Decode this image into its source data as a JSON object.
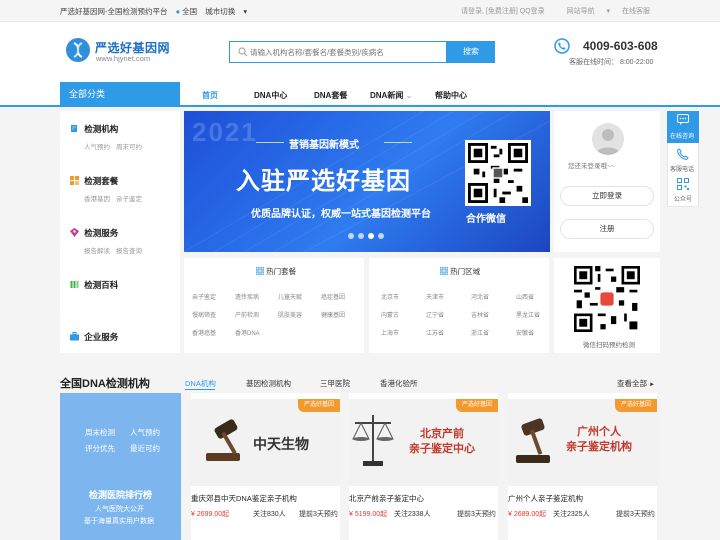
{
  "topbar": {
    "site_name": "严选好基因网-全国检测预约平台",
    "location": "全国",
    "city_switch": "城市切换",
    "login_register": "请登录, [免费注册] QQ登录",
    "site_nav": "网站导航",
    "online_service": "在线客服"
  },
  "header": {
    "logo_title": "严选好基因网",
    "logo_url": "www.hjynet.com",
    "search_placeholder": "请输入机构名称/套餐名/套餐类别/疾病名",
    "search_button": "搜索",
    "phone": "4009-603-608",
    "service_time": "客服在线时间：  8:00-22:00"
  },
  "nav": {
    "all_categories": "全部分类",
    "items": [
      "首页",
      "DNA中心",
      "DNA套餐",
      "DNA新闻",
      "帮助中心"
    ]
  },
  "categories": [
    {
      "title": "检测机构",
      "subs": [
        "人气预约",
        "周末可约"
      ],
      "icon": "building-icon",
      "color": "#2f9ae6"
    },
    {
      "title": "检测套餐",
      "subs": [
        "香港基因",
        "亲子鉴定"
      ],
      "icon": "grid-icon",
      "color": "#f39a2e"
    },
    {
      "title": "检测服务",
      "subs": [
        "报告解读",
        "报告查询"
      ],
      "icon": "service-icon",
      "color": "#d0378a"
    },
    {
      "title": "检测百科",
      "subs": [],
      "icon": "book-icon",
      "color": "#3bb54a"
    },
    {
      "title": "企业服务",
      "subs": [],
      "icon": "briefcase-icon",
      "color": "#2f9ae6"
    }
  ],
  "banner": {
    "year": "2021",
    "tag": "营销基因新模式",
    "headline": "入驻严选好基因",
    "subline": "优质品牌认证，权威一站式基因检测平台",
    "qr_label": "合作微信",
    "slides": 4,
    "active_slide": 2
  },
  "login_panel": {
    "hint": "您还未登录哦~~",
    "login_button": "立即登录",
    "register_button": "注册"
  },
  "float_bar": {
    "consult": "在线咨询",
    "phone": "客服电话",
    "wechat": "公众号"
  },
  "hot_packages": {
    "title": "热门套餐",
    "items": [
      "亲子鉴定",
      "遗传疾病",
      "儿童天赋",
      "癌症基因",
      "慢病筛查",
      "产前检测",
      "肌肤美容",
      "健康基因",
      "香港癌基",
      "香港DNA"
    ]
  },
  "hot_regions": {
    "title": "热门区域",
    "items": [
      "北京市",
      "天津市",
      "河北省",
      "山西省",
      "内蒙古",
      "辽宁省",
      "吉林省",
      "黑龙江省",
      "上海市",
      "江苏省",
      "浙江省",
      "安徽省"
    ]
  },
  "wechat_box": {
    "label": "微信扫码预约检测"
  },
  "section": {
    "title": "全国DNA检测机构",
    "tabs": [
      "DNA机构",
      "基因检测机构",
      "三甲医院",
      "香港化验所"
    ],
    "more": "查看全部"
  },
  "rank": {
    "items": [
      "周末检测",
      "人气预约",
      "评分优先",
      "最近可约"
    ],
    "title": "检测医院排行榜",
    "desc": [
      "人气医院大公开",
      "基于海量真实用户数据"
    ]
  },
  "cards": [
    {
      "badge": "严选好基因",
      "image_text": "中天生物",
      "name": "重庆郊县中天DNA鉴定亲子机构",
      "price": "¥ 2699.00起",
      "follow": "关注830人",
      "days": "提前3天预约"
    },
    {
      "badge": "严选好基因",
      "image_text": "北京产前\n亲子鉴定中心",
      "name": "北京产前亲子鉴定中心",
      "price": "¥ 5199.00起",
      "follow": "关注2338人",
      "days": "提前3天预约"
    },
    {
      "badge": "严选好基因",
      "image_text": "广州个人\n亲子鉴定机构",
      "name": "广州个人亲子鉴定机构",
      "price": "¥ 2689.00起",
      "follow": "关注2325人",
      "days": "提前3天预约"
    }
  ]
}
